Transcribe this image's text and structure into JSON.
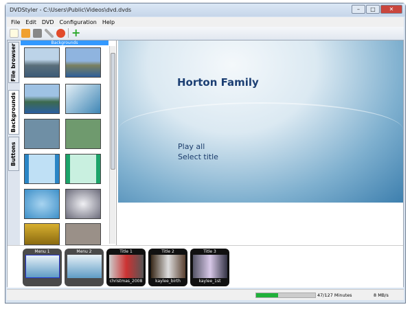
{
  "window": {
    "title": "DVDStyler - C:\\Users\\Public\\Videos\\dvd.dvds"
  },
  "menu": [
    "File",
    "Edit",
    "DVD",
    "Configuration",
    "Help"
  ],
  "toolbar": [
    "new-icon",
    "open-icon",
    "save-icon",
    "settings-icon",
    "burn-icon",
    "add-icon"
  ],
  "side_tabs": [
    "File browser",
    "Backgrounds",
    "Buttons"
  ],
  "panel": {
    "header": "Backgrounds"
  },
  "preview": {
    "title": "Horton Family",
    "buttons": [
      "Play all",
      "Select title"
    ]
  },
  "titleset": [
    {
      "label": "Menu 1",
      "caption": ""
    },
    {
      "label": "Menu 2",
      "caption": ""
    },
    {
      "label": "Title 1",
      "caption": "christmas_2008"
    },
    {
      "label": "Title 2",
      "caption": "kaylee_birth"
    },
    {
      "label": "Title 3",
      "caption": "kaylee_1st"
    }
  ],
  "status": {
    "progress_percent": 37,
    "minutes": "47/127 Minutes",
    "rate": "8 MB/s"
  }
}
